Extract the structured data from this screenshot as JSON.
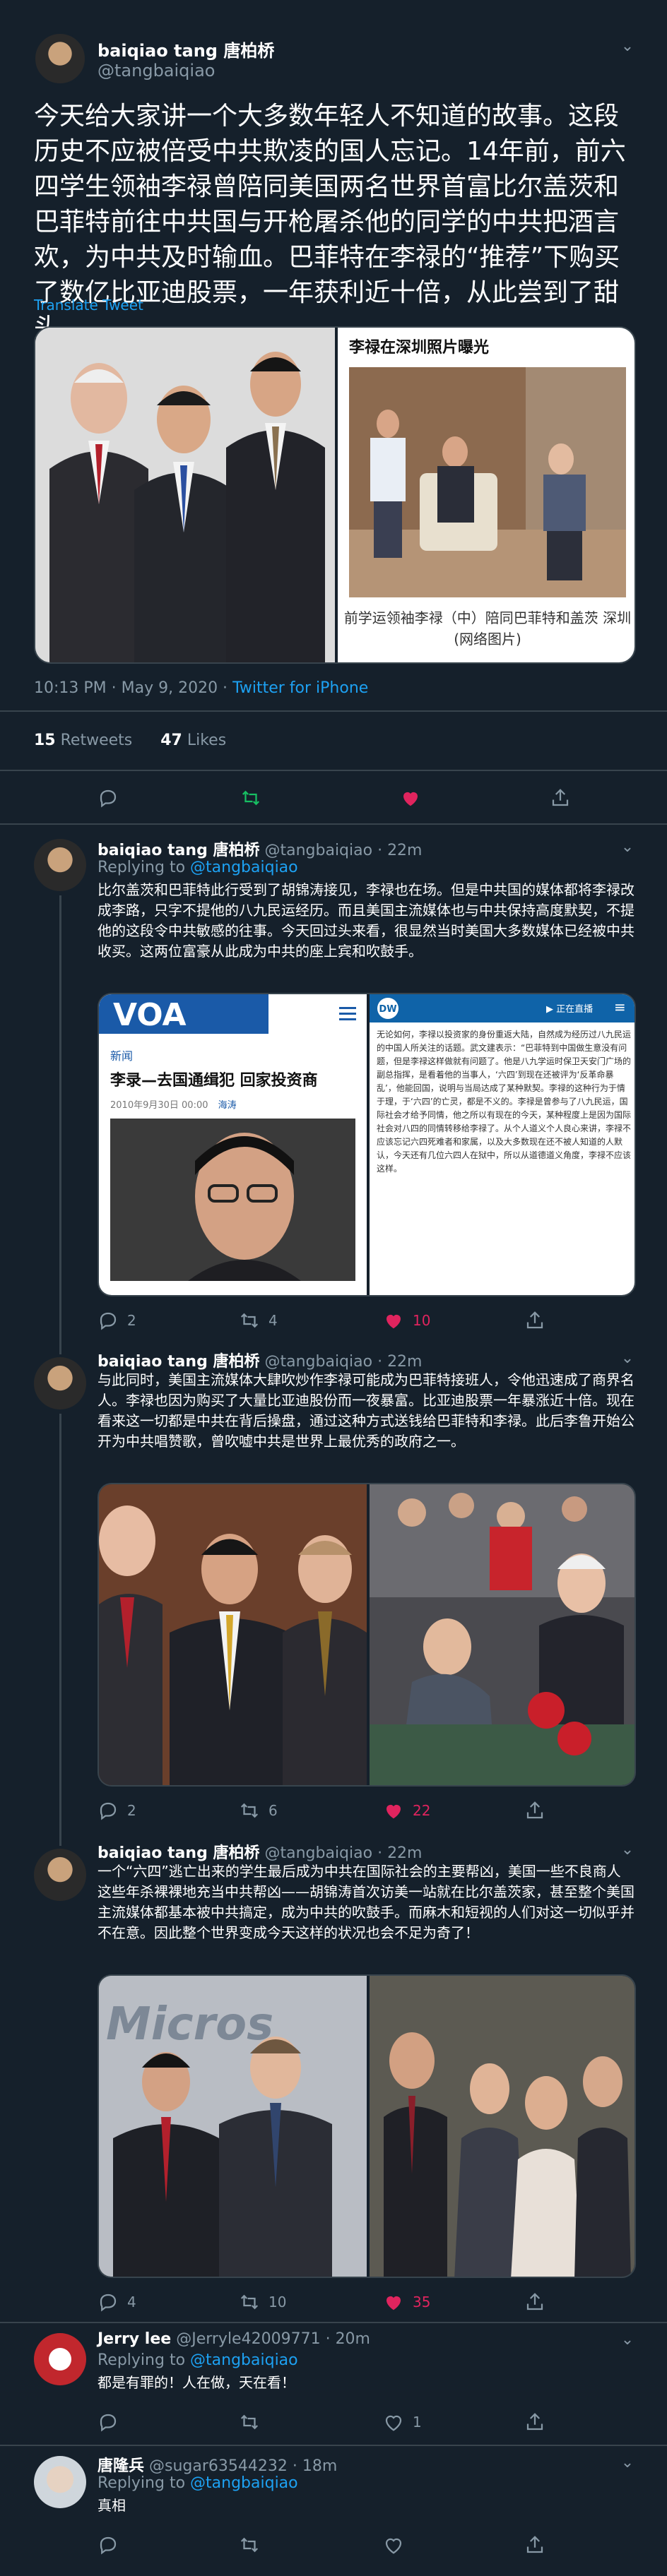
{
  "main": {
    "name": "baiqiao tang 唐柏桥",
    "handle": "@tangbaiqiao",
    "text": "今天给大家讲一个大多数年轻人不知道的故事。这段历史不应被倍受中共欺凌的国人忘记。14年前，前六四学生领袖李禄曾陪同美国两名世界首富比尔盖茨和巴菲特前往中共国与开枪屠杀他的同学的中共把酒言欢，为中共及时输血。巴菲特在李禄的“推荐”下购买了数亿比亚迪股票，一年获利近十倍，从此尝到了甜头。",
    "translate": "Translate Tweet",
    "media_right_title": "李禄在深圳照片曝光",
    "media_right_caption": "前学运领袖李禄（中）陪同巴菲特和盖茨 深圳(网络图片)",
    "time": "10:13 PM · May 9, 2020 · ",
    "source": "Twitter for iPhone",
    "retweets_count": "15",
    "retweets_label": " Retweets",
    "likes_count": "47",
    "likes_label": " Likes"
  },
  "replies": [
    {
      "name": "baiqiao tang 唐柏桥",
      "handle": "@tangbaiqiao",
      "time": "· 22m",
      "replying_prefix": "Replying to ",
      "replying_to": "@tangbaiqiao",
      "text": "比尔盖茨和巴菲特此行受到了胡锦涛接见，李禄也在场。但是中共国的媒体都将李禄改成李路，只字不提他的八九民运经历。而且美国主流媒体也与中共保持高度默契，不提他的这段令中共敏感的往事。今天回过头来看，很显然当时美国大多数媒体已经被中共收买。这两位富豪从此成为中共的座上宾和吹鼓手。",
      "voa_section": "新闻",
      "voa_headline": "李录—去国通缉犯 回家投资商",
      "voa_date": "2010年9月30日 00:00",
      "voa_tag": "海涛",
      "dw_text": "无论如何，李禄以投资家的身份重返大陆，自然成为经历过八九民运的中国人所关注的话题。武文建表示：“巴菲特到中国做生意没有问题，但是李禄这样做就有问题了。他是八九学运时保卫天安门广场的副总指挥，是看着他的当事人，‘六四’到现在还被评为‘反革命暴乱’，他能回国，说明与当局达成了某种默契。李禄的这种行为于情于理，于‘六四’的亡灵，都是不义的。李禄是曾参与了八九民运，国际社会才给予同情，他之所以有现在的今天，某种程度上是因为国际社会对八四的同情转移给李禄了。从个人道义个人良心来讲，李禄不应该忘记六四死难者和家属，以及大多数现在还不被人知道的人默认，今天还有几位六四人在狱中，所以从道德道义角度，李禄不应该这样。",
      "dw_live": "▶ 正在直播",
      "replies_count": "2",
      "retweets_count": "4",
      "likes_count": "10"
    },
    {
      "name": "baiqiao tang 唐柏桥",
      "handle": "@tangbaiqiao",
      "time": "· 22m",
      "text": "与此同时，美国主流媒体大肆吹炒作李禄可能成为巴菲特接班人，令他迅速成了商界名人。李禄也因为购买了大量比亚迪股份而一夜暴富。比亚迪股票一年暴涨近十倍。现在看来这一切都是中共在背后操盘，通过这种方式送钱给巴菲特和李禄。此后李鲁开始公开为中共唱赞歌，曾吹嘘中共是世界上最优秀的政府之一。",
      "replies_count": "2",
      "retweets_count": "6",
      "likes_count": "22"
    },
    {
      "name": "baiqiao tang 唐柏桥",
      "handle": "@tangbaiqiao",
      "time": "· 22m",
      "text": "一个“六四”逃亡出来的学生最后成为中共在国际社会的主要帮凶，美国一些不良商人这些年杀裸裸地充当中共帮凶——胡锦涛首次访美一站就在比尔盖茨家，甚至整个美国主流媒体都基本被中共搞定，成为中共的吹鼓手。而麻木和短视的人们对这一切似乎并不在意。因此整个世界变成今天这样的状况也会不足为奇了！",
      "replies_count": "4",
      "retweets_count": "10",
      "likes_count": "35"
    },
    {
      "name": "Jerry lee",
      "handle": "@Jerryle42009771",
      "time": "· 20m",
      "replying_prefix": "Replying to ",
      "replying_to": "@tangbaiqiao",
      "text": "都是有罪的！人在做，天在看！",
      "replies_count": "",
      "retweets_count": "",
      "likes_count": "1"
    },
    {
      "name": "唐隆兵",
      "handle": "@sugar63544232",
      "time": "· 18m",
      "replying_prefix": "Replying to ",
      "replying_to": "@tangbaiqiao",
      "text": "真相",
      "replies_count": "",
      "retweets_count": "",
      "likes_count": ""
    }
  ],
  "icons": [
    "reply-icon",
    "retweet-icon",
    "like-icon",
    "share-icon",
    "chevron-down-icon"
  ],
  "colors": {
    "background": "#15202b",
    "accent": "#1da1f2",
    "like": "#e0245e",
    "retweet": "#17bf63",
    "muted": "#8899a6"
  }
}
